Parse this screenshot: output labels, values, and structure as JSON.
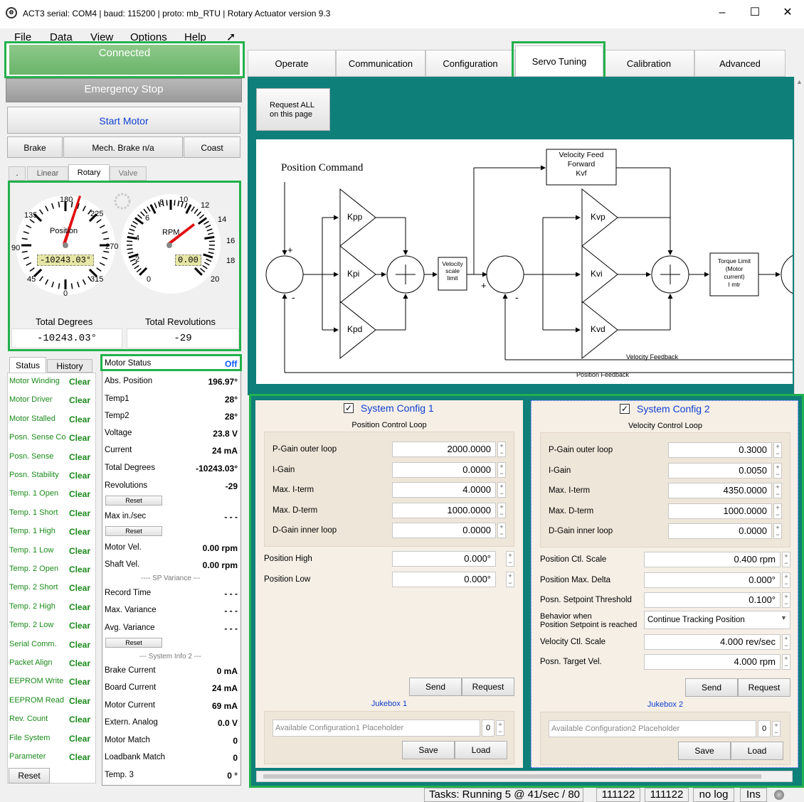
{
  "window": {
    "title": "ACT3  serial: COM4  |  baud: 115200  |  proto: mb_RTU  |  Rotary Actuator version 9.3",
    "icon": "gear-logo-icon",
    "minimize": "–",
    "maximize": "☐",
    "close": "✕"
  },
  "menu": {
    "items": [
      "File",
      "Data",
      "View",
      "Options",
      "Help"
    ],
    "help_icon": "cursor-help-icon"
  },
  "left": {
    "connected": "Connected",
    "emergency": "Emergency Stop",
    "start": "Start Motor",
    "brake": "Brake",
    "mech_brake": "Mech. Brake n/a",
    "coast": "Coast",
    "tabs": [
      ".",
      "Linear",
      "Rotary",
      "Valve"
    ],
    "gauge1": {
      "label": "Position",
      "value": "-10243.03°",
      "ticks": [
        "180",
        "135",
        "225",
        "90",
        "270",
        "45",
        "315",
        "0"
      ],
      "angle_deg": 196.97
    },
    "gauge2": {
      "label": "RPM",
      "value": "0.00",
      "ticks": [
        "8",
        "10",
        "12",
        "6",
        "14",
        "4",
        "16",
        "2",
        "18",
        "0",
        "20"
      ]
    },
    "total_degrees_label": "Total Degrees",
    "total_degrees": "-10243.03°",
    "total_rev_label": "Total Revolutions",
    "total_rev": "-29",
    "status_tabs": [
      "Status",
      "History"
    ],
    "status": [
      {
        "label": "Motor Winding",
        "value": "Clear"
      },
      {
        "label": "Motor Driver",
        "value": "Clear"
      },
      {
        "label": "Motor Stalled",
        "value": "Clear"
      },
      {
        "label": "Posn. Sense Co",
        "value": "Clear"
      },
      {
        "label": "Posn. Sense",
        "value": "Clear"
      },
      {
        "label": "Posn. Stability",
        "value": "Clear"
      },
      {
        "label": "Temp. 1 Open",
        "value": "Clear"
      },
      {
        "label": "Temp. 1 Short",
        "value": "Clear"
      },
      {
        "label": "Temp. 1 High",
        "value": "Clear"
      },
      {
        "label": "Temp. 1 Low",
        "value": "Clear"
      },
      {
        "label": "Temp. 2 Open",
        "value": "Clear"
      },
      {
        "label": "Temp. 2 Short",
        "value": "Clear"
      },
      {
        "label": "Temp. 2 High",
        "value": "Clear"
      },
      {
        "label": "Temp. 2 Low",
        "value": "Clear"
      },
      {
        "label": "Serial Comm.",
        "value": "Clear"
      },
      {
        "label": "Packet Align",
        "value": "Clear"
      },
      {
        "label": "EEPROM Write",
        "value": "Clear"
      },
      {
        "label": "EEPROM Read",
        "value": "Clear"
      },
      {
        "label": "Rev. Count",
        "value": "Clear"
      },
      {
        "label": "File System",
        "value": "Clear"
      },
      {
        "label": "Parameter",
        "value": "Clear"
      }
    ],
    "reset": "Reset",
    "motor_status_label": "Motor Status",
    "motor_status": "Off",
    "motor": [
      {
        "label": "Abs. Position",
        "value": "196.97°"
      },
      {
        "label": "Temp1",
        "value": "28°"
      },
      {
        "label": "Temp2",
        "value": "28°"
      },
      {
        "label": "Voltage",
        "value": "23.8 V"
      },
      {
        "label": "Current",
        "value": "24 mA"
      },
      {
        "label": "Total Degrees",
        "value": "-10243.03°"
      },
      {
        "label": "Revolutions",
        "value": "-29"
      },
      {
        "label": "Max in./sec",
        "value": "- - -"
      },
      {
        "label": "Motor Vel.",
        "value": "0.00 rpm"
      },
      {
        "label": "Shaft Vel.",
        "value": "0.00 rpm"
      },
      {
        "label": "Record Time",
        "value": "- - -"
      },
      {
        "label": "Max. Variance",
        "value": "- - -"
      },
      {
        "label": "Avg. Variance",
        "value": "- - -"
      },
      {
        "label": "Brake Current",
        "value": "0 mA"
      },
      {
        "label": "Board Current",
        "value": "24 mA"
      },
      {
        "label": "Motor Current",
        "value": "69 mA"
      },
      {
        "label": "Extern. Analog",
        "value": "0.0 V"
      },
      {
        "label": "Motor Match",
        "value": "0"
      },
      {
        "label": "Loadbank Match",
        "value": "0"
      },
      {
        "label": "Temp. 3",
        "value": "0 °"
      }
    ],
    "sp_variance": "---- SP Variance ---",
    "sys_info": "--- System Info 2 ---"
  },
  "tabs": [
    "Operate",
    "Communication",
    "Configuration",
    "Servo Tuning",
    "Calibration",
    "Advanced"
  ],
  "request_all": "Request ALL\non this page",
  "diagram": {
    "title": "Position Command",
    "vff": "Velocity Feed\nForward\nKvf",
    "vsl": "Velocity\nscale\nlimit",
    "torque": "Torque Limit\n(Motor\ncurrent)\nI mtr",
    "vel_fb": "Velocity Feedback",
    "pos_fb": "Position Feedback",
    "kpp": "Kpp",
    "kpi": "Kpi",
    "kpd": "Kpd",
    "kvp": "Kvp",
    "kvi": "Kvi",
    "kvd": "Kvd",
    "plus": "+",
    "minus": "-"
  },
  "cfg1": {
    "title": "System Config 1",
    "subtitle": "Position Control Loop",
    "checked": "✓",
    "rows": [
      {
        "label": "P-Gain outer loop",
        "value": "2000.0000"
      },
      {
        "label": "I-Gain",
        "value": "0.0000"
      },
      {
        "label": "Max. I-term",
        "value": "4.0000"
      },
      {
        "label": "Max. D-term",
        "value": "1000.0000"
      },
      {
        "label": "D-Gain inner loop",
        "value": "0.0000"
      }
    ],
    "rows2": [
      {
        "label": "Position High",
        "value": "0.000°"
      },
      {
        "label": "Position Low",
        "value": "0.000°"
      }
    ],
    "send": "Send",
    "request": "Request",
    "jukebox": "Jukebox  1",
    "placeholder": "Available Configuration1 Placeholder",
    "count": "0",
    "save": "Save",
    "load": "Load"
  },
  "cfg2": {
    "title": "System Config 2",
    "subtitle": "Velocity Control Loop",
    "checked": "✓",
    "rows": [
      {
        "label": "P-Gain outer loop",
        "value": "0.3000"
      },
      {
        "label": "I-Gain",
        "value": "0.0050"
      },
      {
        "label": "Max. I-term",
        "value": "4350.0000"
      },
      {
        "label": "Max. D-term",
        "value": "1000.0000"
      },
      {
        "label": "D-Gain inner loop",
        "value": "0.0000"
      }
    ],
    "rows2": [
      {
        "label": "Position Ctl. Scale",
        "value": "0.400 rpm"
      },
      {
        "label": "Position Max. Delta",
        "value": "0.000°"
      },
      {
        "label": "Posn. Setpoint Threshold",
        "value": "0.100°"
      }
    ],
    "behavior_label": "Behavior when\nPosition Setpoint is reached",
    "behavior": "Continue Tracking Position",
    "rows3": [
      {
        "label": "Velocity Ctl. Scale",
        "value": "4.000 rev/sec"
      },
      {
        "label": "Posn. Target Vel.",
        "value": "4.000 rpm"
      }
    ],
    "send": "Send",
    "request": "Request",
    "jukebox": "Jukebox  2",
    "placeholder": "Available Configuration2 Placeholder",
    "count": "0",
    "save": "Save",
    "load": "Load"
  },
  "statusbar": {
    "tasks": "Tasks: Running 5 @ 41/sec / 80",
    "c1": "111122",
    "c2": "111122",
    "log": "no log",
    "ins": "Ins"
  },
  "colors": {
    "teal": "#0f7f7a",
    "green_highlight": "#22b14c",
    "clear_green": "#1a8a1a",
    "motor_off": "#0a58ff",
    "link_blue": "#1040d0"
  }
}
